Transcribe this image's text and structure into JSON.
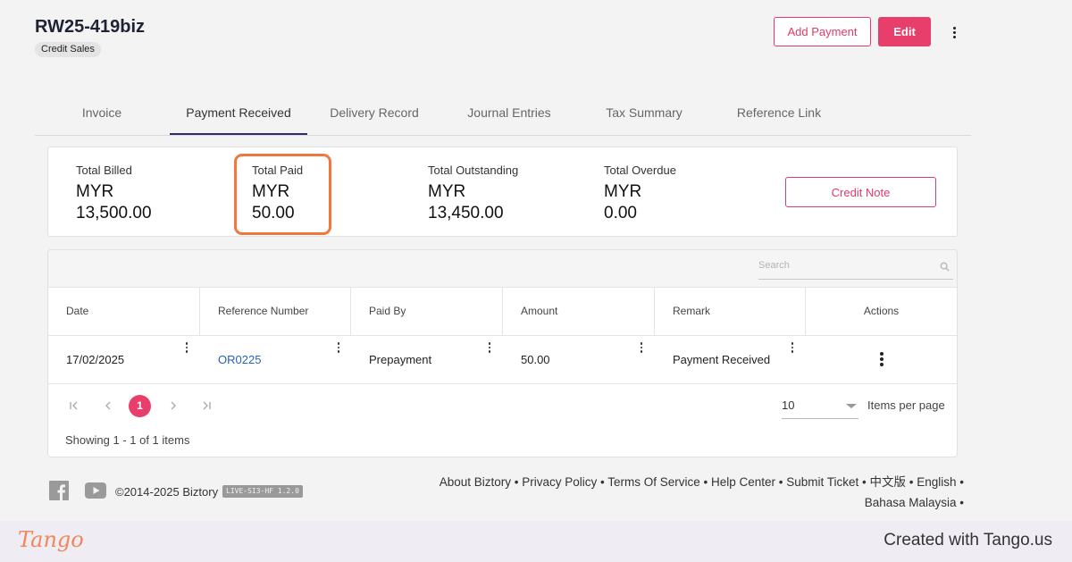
{
  "header": {
    "title": "RW25-419biz",
    "badge": "Credit Sales",
    "add_payment_label": "Add Payment",
    "edit_label": "Edit"
  },
  "tabs": [
    {
      "label": "Invoice",
      "active": false
    },
    {
      "label": "Payment Received",
      "active": true
    },
    {
      "label": "Delivery Record",
      "active": false
    },
    {
      "label": "Journal Entries",
      "active": false
    },
    {
      "label": "Tax Summary",
      "active": false
    },
    {
      "label": "Reference Link",
      "active": false
    }
  ],
  "summary": {
    "billed": {
      "label": "Total Billed",
      "currency": "MYR",
      "value": "13,500.00"
    },
    "paid": {
      "label": "Total Paid",
      "currency": "MYR",
      "value": "50.00"
    },
    "outstanding": {
      "label": "Total Outstanding",
      "currency": "MYR",
      "value": "13,450.00"
    },
    "overdue": {
      "label": "Total Overdue",
      "currency": "MYR",
      "value": "0.00"
    },
    "credit_note_label": "Credit Note"
  },
  "grid": {
    "search_placeholder": "Search",
    "columns": [
      "Date",
      "Reference Number",
      "Paid By",
      "Amount",
      "Remark",
      "Actions"
    ],
    "rows": [
      {
        "date": "17/02/2025",
        "reference": "OR0225",
        "paid_by": "Prepayment",
        "amount": "50.00",
        "remark": "Payment Received"
      }
    ],
    "pager": {
      "current_page": "1",
      "page_size": "10",
      "items_per_page_label": "Items per page",
      "showing": "Showing 1 - 1 of 1 items"
    }
  },
  "footer": {
    "copyright": "©2014-2025 Biztory",
    "version": "LIVE-SI3-HF 1.2.0",
    "links_line1": "About Biztory • Privacy Policy • Terms Of Service • Help Center • Submit Ticket • 中文版 • English •",
    "links_line2": "Bahasa Malaysia •"
  },
  "tango": {
    "logo": "Tango",
    "credit": "Created with Tango.us"
  },
  "colors": {
    "accent": "#e83e6c",
    "tab_indicator": "#2e2b6e",
    "highlight": "#f0783c",
    "link": "#2a62b6"
  }
}
